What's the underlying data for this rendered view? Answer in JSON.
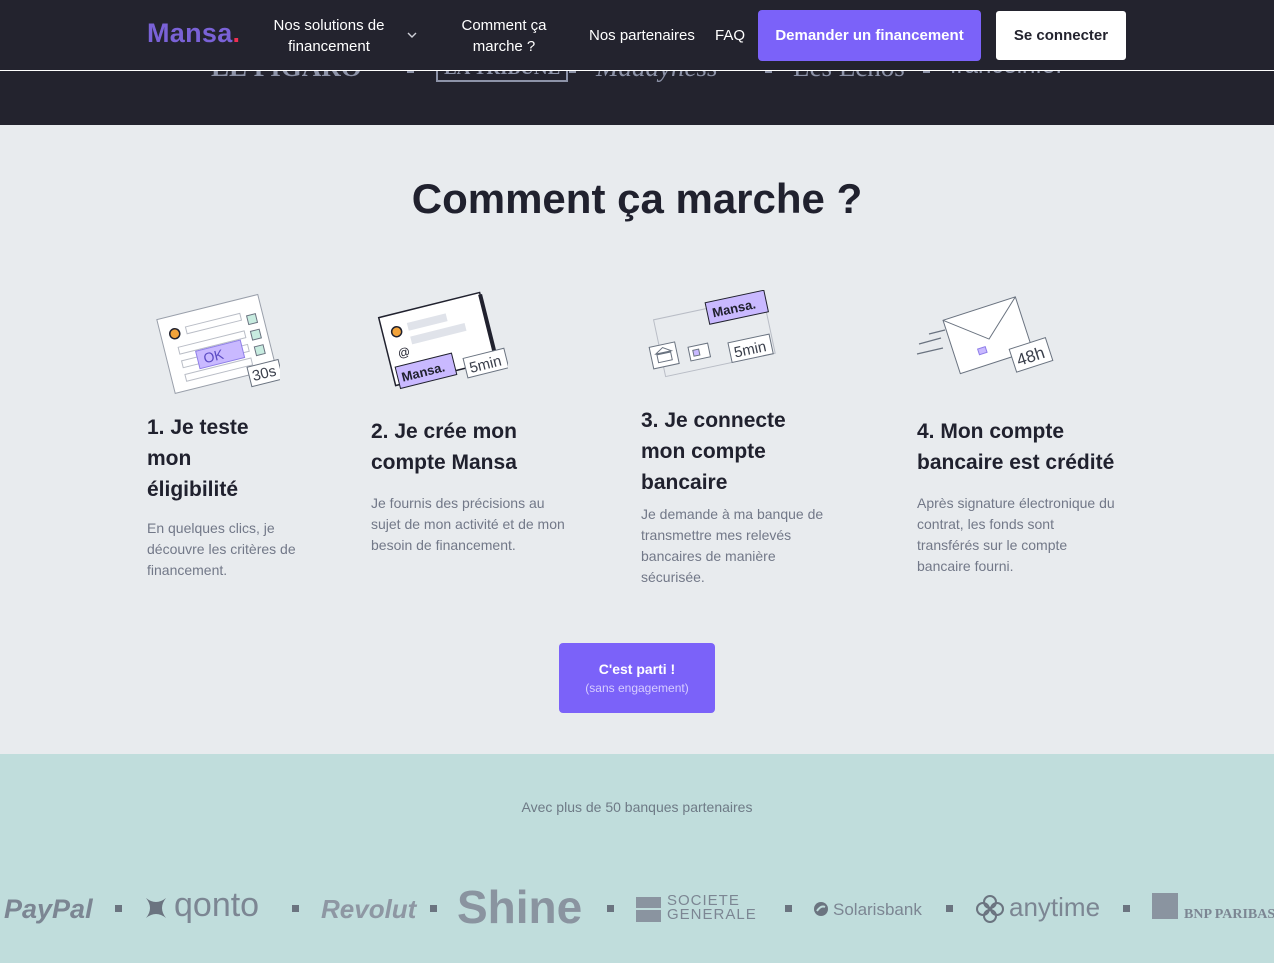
{
  "header": {
    "logo": "Mansa",
    "logo_dot": ".",
    "nav": {
      "solutions": "Nos solutions de financement",
      "how": "Comment ça marche ?",
      "partners": "Nos partenaires",
      "faq": "FAQ"
    },
    "cta_financing": "Demander un financement",
    "login": "Se connecter"
  },
  "press": [
    "LE FIGARO",
    "LA TRIBUNE",
    "Maddyness",
    "Les Echos",
    "franceinfo:"
  ],
  "how": {
    "title": "Comment ça marche ?",
    "steps": [
      {
        "title": "1. Je teste mon éligibilité",
        "desc": "En quelques clics, je découvre les critères de financement.",
        "badge": "30s",
        "stamp": "OK"
      },
      {
        "title": "2. Je crée mon compte Mansa",
        "desc": "Je fournis des précisions au sujet de mon activité et de mon besoin de financement.",
        "badge": "5min",
        "stamp": "Mansa."
      },
      {
        "title": "3. Je connecte mon compte bancaire",
        "desc": "Je demande à ma banque de transmettre mes relevés bancaires de manière sécurisée.",
        "badge": "5min",
        "stamp": "Mansa."
      },
      {
        "title": "4. Mon compte bancaire est crédité",
        "desc": "Après signature électronique du contrat, les fonds sont transférés sur le compte bancaire fourni.",
        "badge": "48h"
      }
    ],
    "cta": {
      "label": "C'est parti !",
      "sub": "(sans engagement)"
    }
  },
  "banks": {
    "caption": "Avec plus de 50 banques partenaires",
    "logos": [
      "PayPal",
      "qonto",
      "Revolut",
      "Shine",
      "SOCIETE GENERALE",
      "Solarisbank",
      "anytime",
      "BNP PARIBAS"
    ]
  },
  "colors": {
    "primary": "#7b62f9",
    "dark": "#23232e",
    "light_bg": "#e8ebee",
    "teal_bg": "#c0dddc",
    "logo_dot": "#ef2f52"
  }
}
